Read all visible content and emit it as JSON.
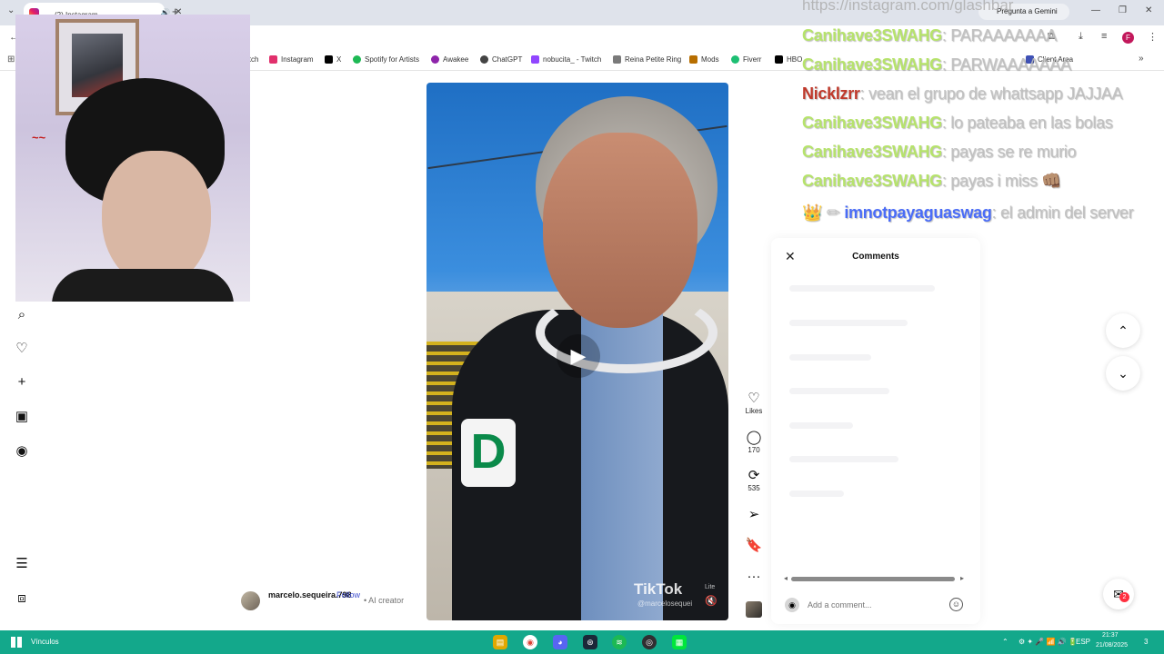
{
  "browser": {
    "tab_title": "(2) Instagram",
    "gemini_label": "Pregunta a Gemini",
    "profile_initial": "F",
    "bookmarks": [
      {
        "label": "itch",
        "color": "#9146ff"
      },
      {
        "label": "Instagram",
        "color": "#e1306c"
      },
      {
        "label": "X",
        "color": "#000000"
      },
      {
        "label": "Spotify for Artists",
        "color": "#1db954"
      },
      {
        "label": "Awakee",
        "color": "#8e24aa"
      },
      {
        "label": "ChatGPT",
        "color": "#444444"
      },
      {
        "label": "nobucita_ - Twitch",
        "color": "#9146ff"
      },
      {
        "label": "Reina Petite Ring",
        "color": "#7a7a7a"
      },
      {
        "label": "Mods",
        "color": "#b76e00"
      },
      {
        "label": "Fiverr",
        "color": "#1dbf73"
      },
      {
        "label": "HBO",
        "color": "#000000"
      },
      {
        "label": "Client Area",
        "color": "#3f51b5"
      }
    ]
  },
  "chat": {
    "url": "https://instagram.com/glashbar",
    "messages": [
      {
        "user": "Canihave3SWAHG",
        "text": ": PARAAAAAAA",
        "color": "#b6e36b"
      },
      {
        "user": "Canihave3SWAHG",
        "text": ": PARWAAAAAAA",
        "color": "#b6e36b"
      },
      {
        "user": "Nicklzrr",
        "text": ": vean el grupo de whattsapp JAJJAA",
        "color": "#c0392b"
      },
      {
        "user": "Canihave3SWAHG",
        "text": ": lo pateaba en las bolas",
        "color": "#b6e36b"
      },
      {
        "user": "Canihave3SWAHG",
        "text": ": payas se re murio",
        "color": "#b6e36b"
      },
      {
        "user": "Canihave3SWAHG",
        "text": ": payas i miss 👊🏽",
        "color": "#b6e36b"
      },
      {
        "user": "imnotpayaguaswag",
        "text": ": el admin del server",
        "color": "#4a6cf7",
        "badges": "👑 ✏"
      }
    ]
  },
  "post": {
    "author": "marcelo.sequeira.798",
    "follow_label": "Follow",
    "ai_label": "• AI creator",
    "watermark": "TikTok",
    "watermark_sub": "@marcelosequei",
    "lite": "Lite",
    "likes_label": "Likes",
    "comments_count": "170",
    "reposts_count": "535"
  },
  "comments_panel": {
    "title": "Comments",
    "input_placeholder": "Add a comment..."
  },
  "dm_badge": "2",
  "taskbar": {
    "links_label": "Vínculos",
    "lang": "ESP",
    "time": "21:37",
    "date": "21/08/2025",
    "notif": "3"
  }
}
